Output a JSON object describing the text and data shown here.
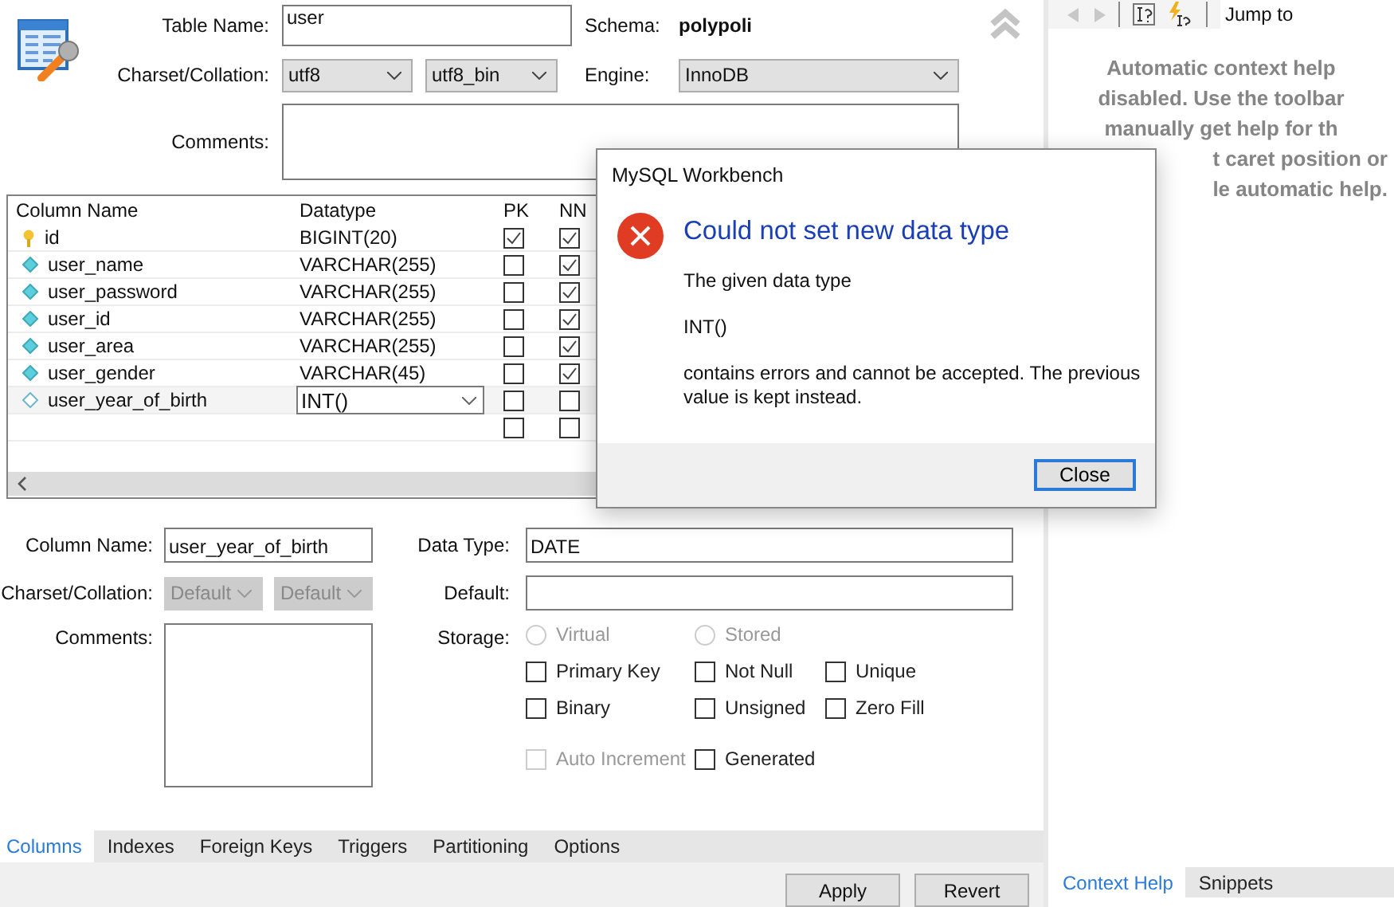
{
  "header": {
    "table_name_label": "Table Name:",
    "table_name": "user",
    "schema_label": "Schema:",
    "schema": "polypoli",
    "charset_label": "Charset/Collation:",
    "charset": "utf8",
    "collation": "utf8_bin",
    "engine_label": "Engine:",
    "engine": "InnoDB",
    "comments_label": "Comments:"
  },
  "grid": {
    "columns": [
      "Column Name",
      "Datatype",
      "PK",
      "NN"
    ],
    "rows": [
      {
        "name": "id",
        "kind": "key",
        "datatype": "BIGINT(20)",
        "pk": true,
        "nn": true,
        "editing": false
      },
      {
        "name": "user_name",
        "kind": "diamond",
        "datatype": "VARCHAR(255)",
        "pk": false,
        "nn": true,
        "editing": false
      },
      {
        "name": "user_password",
        "kind": "diamond",
        "datatype": "VARCHAR(255)",
        "pk": false,
        "nn": true,
        "editing": false
      },
      {
        "name": "user_id",
        "kind": "diamond",
        "datatype": "VARCHAR(255)",
        "pk": false,
        "nn": true,
        "editing": false
      },
      {
        "name": "user_area",
        "kind": "diamond",
        "datatype": "VARCHAR(255)",
        "pk": false,
        "nn": true,
        "editing": false
      },
      {
        "name": "user_gender",
        "kind": "diamond",
        "datatype": "VARCHAR(45)",
        "pk": false,
        "nn": true,
        "editing": false
      },
      {
        "name": "user_year_of_birth",
        "kind": "nullable",
        "datatype": "INT()",
        "pk": false,
        "nn": false,
        "editing": true
      },
      {
        "pk": false,
        "nn": false,
        "editing": false
      }
    ]
  },
  "details": {
    "column_name_label": "Column Name:",
    "column_name": "user_year_of_birth",
    "data_type_label": "Data Type:",
    "data_type": "DATE",
    "charset_label": "Charset/Collation:",
    "charset": "Default",
    "collation": "Default",
    "default_label": "Default:",
    "comments_label": "Comments:",
    "storage_label": "Storage:",
    "storage": [
      {
        "label": "Virtual",
        "selected": false,
        "disabled": true
      },
      {
        "label": "Stored",
        "selected": false,
        "disabled": true
      }
    ],
    "options": [
      {
        "label": "Primary Key",
        "checked": false,
        "disabled": false
      },
      {
        "label": "Not Null",
        "checked": false,
        "disabled": false
      },
      {
        "label": "Unique",
        "checked": false,
        "disabled": false
      },
      {
        "label": "Binary",
        "checked": false,
        "disabled": false
      },
      {
        "label": "Unsigned",
        "checked": false,
        "disabled": false
      },
      {
        "label": "Zero Fill",
        "checked": false,
        "disabled": false
      },
      {
        "label": "Auto Increment",
        "checked": false,
        "disabled": true
      },
      {
        "label": "Generated",
        "checked": false,
        "disabled": false
      }
    ]
  },
  "tabs": [
    {
      "label": "Columns",
      "selected": true
    },
    {
      "label": "Indexes",
      "selected": false
    },
    {
      "label": "Foreign Keys",
      "selected": false
    },
    {
      "label": "Triggers",
      "selected": false
    },
    {
      "label": "Partitioning",
      "selected": false
    },
    {
      "label": "Options",
      "selected": false
    }
  ],
  "buttons": [
    "Apply",
    "Revert"
  ],
  "help_panel": {
    "jump_to": "Jump to",
    "lines": [
      "Automatic context help",
      "disabled. Use the toolbar",
      "manually get help for th",
      "t caret position or",
      "le automatic help."
    ],
    "tabs": [
      {
        "label": "Context Help",
        "selected": true
      },
      {
        "label": "Snippets",
        "selected": false
      }
    ]
  },
  "dialog": {
    "title": "MySQL Workbench",
    "heading": "Could not set new data type",
    "lines": [
      "The given data type",
      "INT()",
      "contains errors and cannot be accepted. The previous value is kept instead."
    ],
    "button": "Close"
  }
}
